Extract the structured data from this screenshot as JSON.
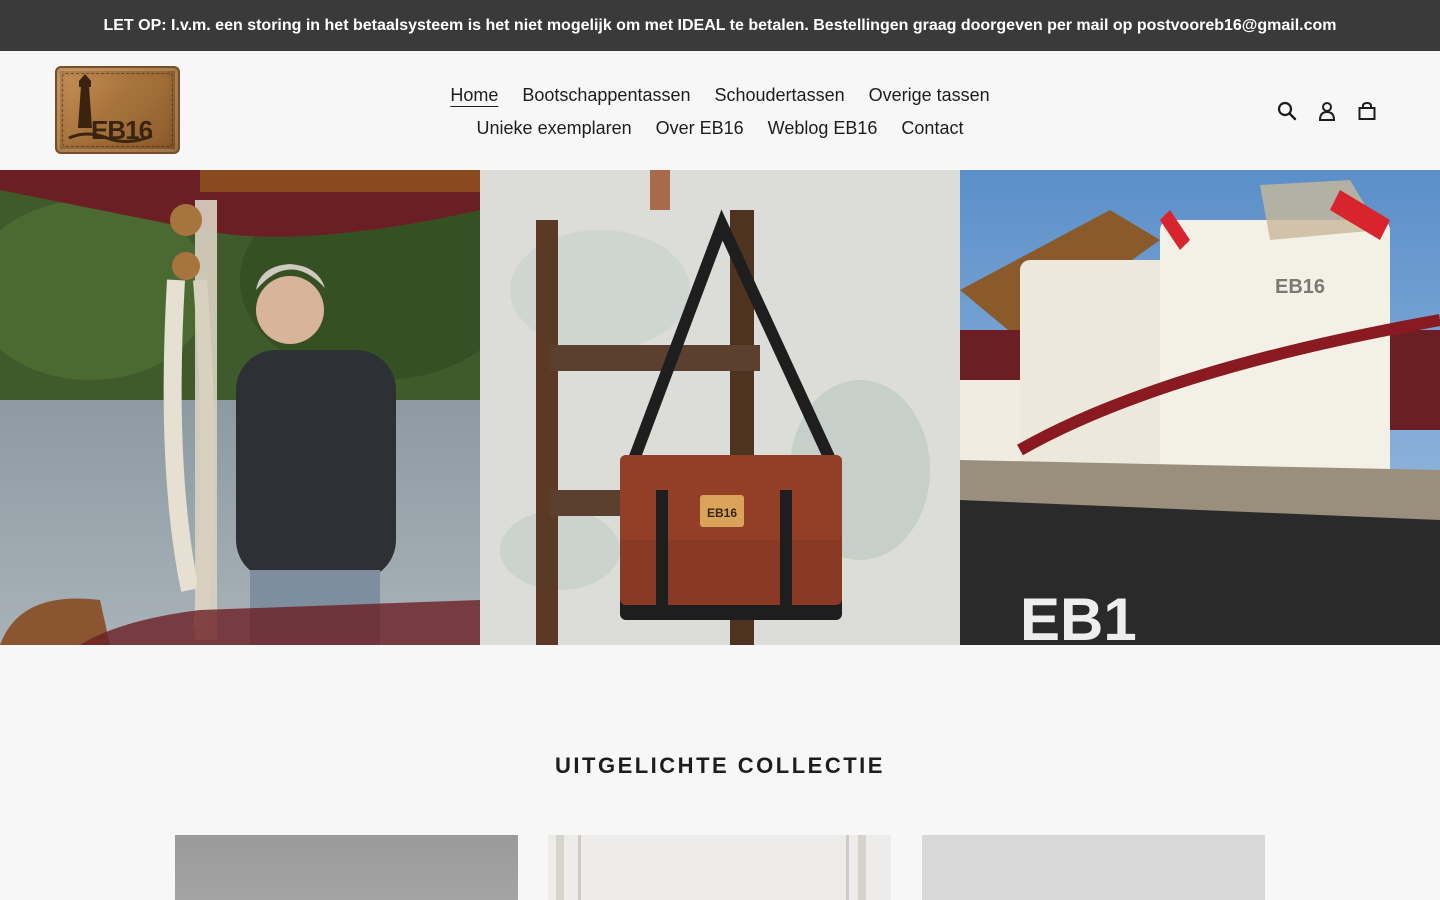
{
  "announcement": {
    "text": "LET OP: I.v.m. een storing in het betaalsysteem is het niet mogelijk om met IDEAL te betalen. Bestellingen graag doorgeven per mail op postvooreb16@gmail.com"
  },
  "logo": {
    "text": "EB16"
  },
  "nav": {
    "row1": [
      "Home",
      "Bootschappentassen",
      "Schoudertassen",
      "Overige tassen"
    ],
    "row2": [
      "Unieke exemplaren",
      "Over EB16",
      "Weblog EB16",
      "Contact"
    ],
    "active": "Home"
  },
  "header_icons": [
    "search-icon",
    "account-icon",
    "cart-icon"
  ],
  "hero": {
    "images": [
      "Woman in dark fleece standing on sailing boat with coiled ropes and pulley block, lake and trees behind",
      "Rust-brown messenger bag with black straps hanging on a wooden ladder against weathered wall",
      "White canvas tote bags with EB16 print on a boat deck with red railing"
    ],
    "image3_hull_text": "EB1"
  },
  "featured": {
    "title": "UITGELICHTE COLLECTIE"
  },
  "colors": {
    "announcement_bg": "#3a3a3a",
    "page_bg": "#f7f7f7",
    "text": "#1c1d1d"
  }
}
